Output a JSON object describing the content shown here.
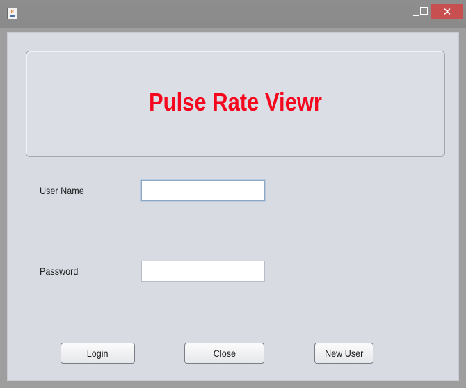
{
  "window": {
    "title": "",
    "controls": {
      "minimize": "minimize",
      "maximize": "maximize",
      "close_glyph": "✕"
    },
    "icon": "java-cup-icon"
  },
  "header": {
    "title": "Pulse Rate Viewr"
  },
  "form": {
    "username_label": "User Name",
    "username_value": "",
    "password_label": "Password",
    "password_value": ""
  },
  "buttons": {
    "login": "Login",
    "close": "Close",
    "new_user": "New User"
  },
  "colors": {
    "title_red": "#f5071e",
    "client_bg": "#d9dbe3",
    "close_button": "#c74f50"
  }
}
